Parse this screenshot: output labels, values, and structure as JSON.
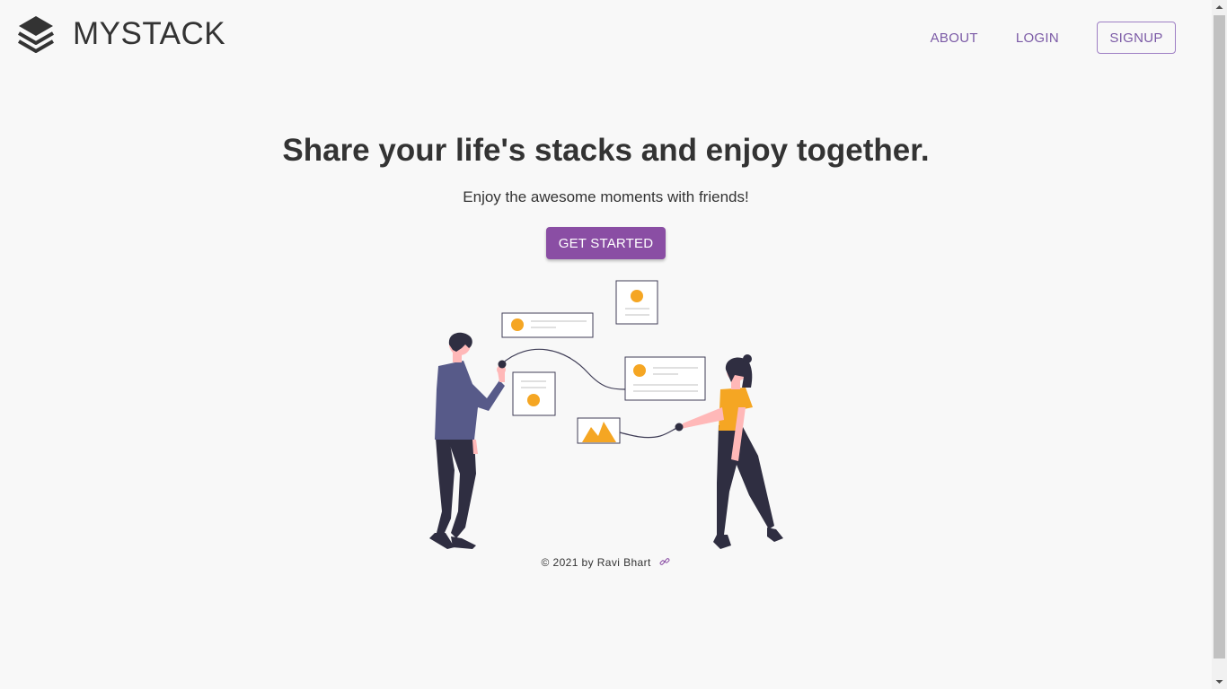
{
  "app": {
    "brand_name": "MYSTACK",
    "brand_icon": "layers-stack-icon"
  },
  "nav": {
    "about_label": "ABOUT",
    "login_label": "LOGIN",
    "signup_label": "SIGNUP"
  },
  "hero": {
    "title": "Share your life's stacks and enjoy together.",
    "subtitle": "Enjoy the awesome moments with friends!",
    "cta_label": "GET STARTED"
  },
  "footer": {
    "text": "© 2021 by Ravi Bhart",
    "link_icon": "link-icon"
  },
  "colors": {
    "accent": "#8a4ea4",
    "nav_text": "#7b5aa6",
    "illustration_orange": "#f5a623",
    "illustration_dark": "#2f2e41",
    "illustration_shirt": "#575a89",
    "skin": "#ffb8b8",
    "background": "#f8f8f8"
  }
}
